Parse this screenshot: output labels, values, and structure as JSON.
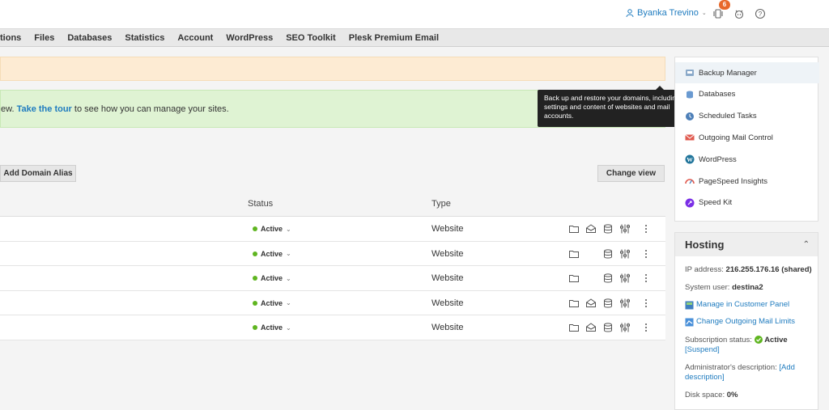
{
  "topbar": {
    "user_name": "Byanka Trevino",
    "notification_count": "6"
  },
  "nav": {
    "tabs": [
      {
        "label": "tions"
      },
      {
        "label": "Files"
      },
      {
        "label": "Databases"
      },
      {
        "label": "Statistics"
      },
      {
        "label": "Account"
      },
      {
        "label": "WordPress"
      },
      {
        "label": "SEO Toolkit"
      },
      {
        "label": "Plesk Premium Email"
      }
    ]
  },
  "info_banner": {
    "prefix": "ew. ",
    "link": "Take the tour",
    "suffix": " to see how you can manage your sites."
  },
  "toolbar": {
    "add_alias_label": "Add Domain Alias",
    "change_view_label": "Change view"
  },
  "table": {
    "headers": {
      "status": "Status",
      "type": "Type"
    },
    "rows": [
      {
        "status": "Active",
        "type": "Website",
        "mail": true
      },
      {
        "status": "Active",
        "type": "Website",
        "mail": false
      },
      {
        "status": "Active",
        "type": "Website",
        "mail": false
      },
      {
        "status": "Active",
        "type": "Website",
        "mail": true
      },
      {
        "status": "Active",
        "type": "Website",
        "mail": true
      }
    ]
  },
  "tooltip": {
    "text": "Back up and restore your domains, including settings and content of websites and mail accounts."
  },
  "tools": {
    "items": [
      {
        "label": "Backup Manager",
        "icon": "backup-icon"
      },
      {
        "label": "Databases",
        "icon": "database-icon"
      },
      {
        "label": "Scheduled Tasks",
        "icon": "clock-icon"
      },
      {
        "label": "Outgoing Mail Control",
        "icon": "mail-icon"
      },
      {
        "label": "WordPress",
        "icon": "wordpress-icon"
      },
      {
        "label": "PageSpeed Insights",
        "icon": "speed-icon"
      },
      {
        "label": "Speed Kit",
        "icon": "rocket-icon"
      }
    ]
  },
  "hosting": {
    "title": "Hosting",
    "ip_label": "IP address:",
    "ip_value": "216.255.176.16 (shared)",
    "system_user_label": "System user:",
    "system_user_value": "destina2",
    "manage_link": "Manage in Customer Panel",
    "mail_limits_link": "Change Outgoing Mail Limits",
    "subscription_label": "Subscription status:",
    "subscription_value": "Active",
    "suspend_link": "[Suspend]",
    "admin_desc_label": "Administrator's description:",
    "admin_desc_link": "[Add description]",
    "disk_label": "Disk space:",
    "disk_value": "0%"
  },
  "colors": {
    "accent": "#1e7bbf",
    "active_dot": "#5fb520",
    "badge": "#e8682a"
  }
}
